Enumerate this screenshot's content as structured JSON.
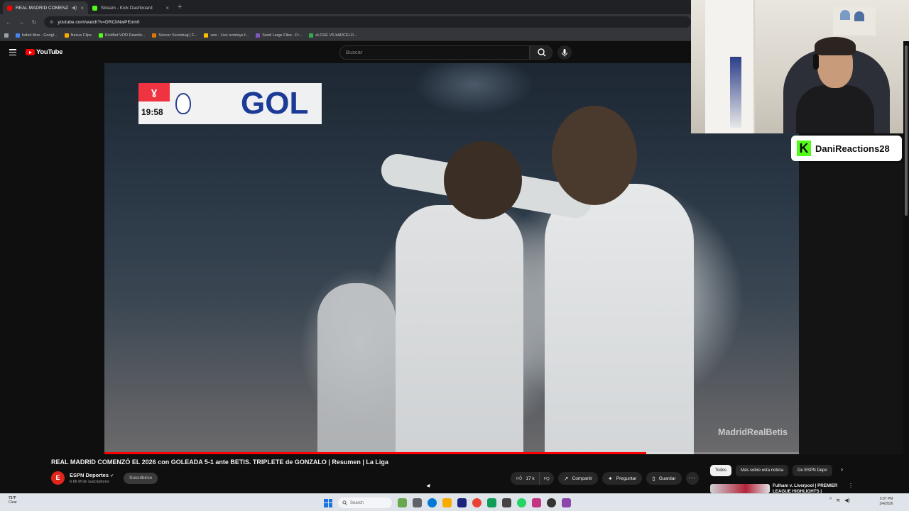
{
  "browser": {
    "tabs": [
      {
        "title": "REAL MADRID COMENZÓ",
        "favicon_color": "#ff0000",
        "active": true
      },
      {
        "title": "Stream - Kick Dashboard",
        "favicon_color": "#53fc18",
        "active": false
      }
    ],
    "url": "youtube.com/watch?v=DRCbNwPEom0",
    "bookmarks": [
      {
        "label": "futbol libre - Googl...",
        "color": "#4285f4"
      },
      {
        "label": "Nexus Clips",
        "color": "#f9ab00"
      },
      {
        "label": "KickBot VOD Downlo...",
        "color": "#53fc18"
      },
      {
        "label": "Soccer Scorebug | F...",
        "color": "#e37400"
      },
      {
        "label": "uno - Live overlays f...",
        "color": "#fbbc04"
      },
      {
        "label": "Send Large Files - Fr...",
        "color": "#7e57c2"
      },
      {
        "label": "eLCHE VS bARCELO...",
        "color": "#34a853"
      }
    ]
  },
  "youtube": {
    "logo_text": "YouTube",
    "search_placeholder": "Buscar"
  },
  "video": {
    "scorebug_clock": "19:58",
    "scorebug_laliga": "ɣ",
    "scorebug_text": "GOL",
    "watermark": "MadridRealBetis",
    "progress_fraction": 0.78
  },
  "stream_overlay": {
    "channel_name": "DaniReactions28",
    "platform_logo": "K"
  },
  "details": {
    "title": "REAL MADRID COMENZÓ EL 2026 con GOLEADA 5-1 ante BETIS. TRIPLETE de GONZALO | Resumen | La Liga",
    "channel": "ESPN Deportes",
    "subscribers": "6.66 M de suscriptores",
    "subscribe_label": "Suscribirse",
    "likes": "17 k",
    "share_label": "Compartir",
    "ask_label": "Preguntar",
    "save_label": "Guardar",
    "more_label": "⋯"
  },
  "chips": [
    "Todos",
    "Más sobre esta noticia",
    "De ESPN Depo"
  ],
  "related": {
    "title": "Fulham v. Liverpool | PREMIER LEAGUE HIGHLIGHTS |"
  },
  "taskbar": {
    "weather_temp": "71°F",
    "weather_desc": "Clear",
    "search_label": "Search",
    "time": "5:07 PM",
    "date": "1/4/2026",
    "icon_colors": [
      "#6aa84f",
      "#5f6368",
      "#0078d4",
      "#f9ab00",
      "#1a237e",
      "#ea4335",
      "#0f9d58",
      "#444",
      "#25d366",
      "#c13584",
      "#333",
      "#8e44ad"
    ]
  }
}
